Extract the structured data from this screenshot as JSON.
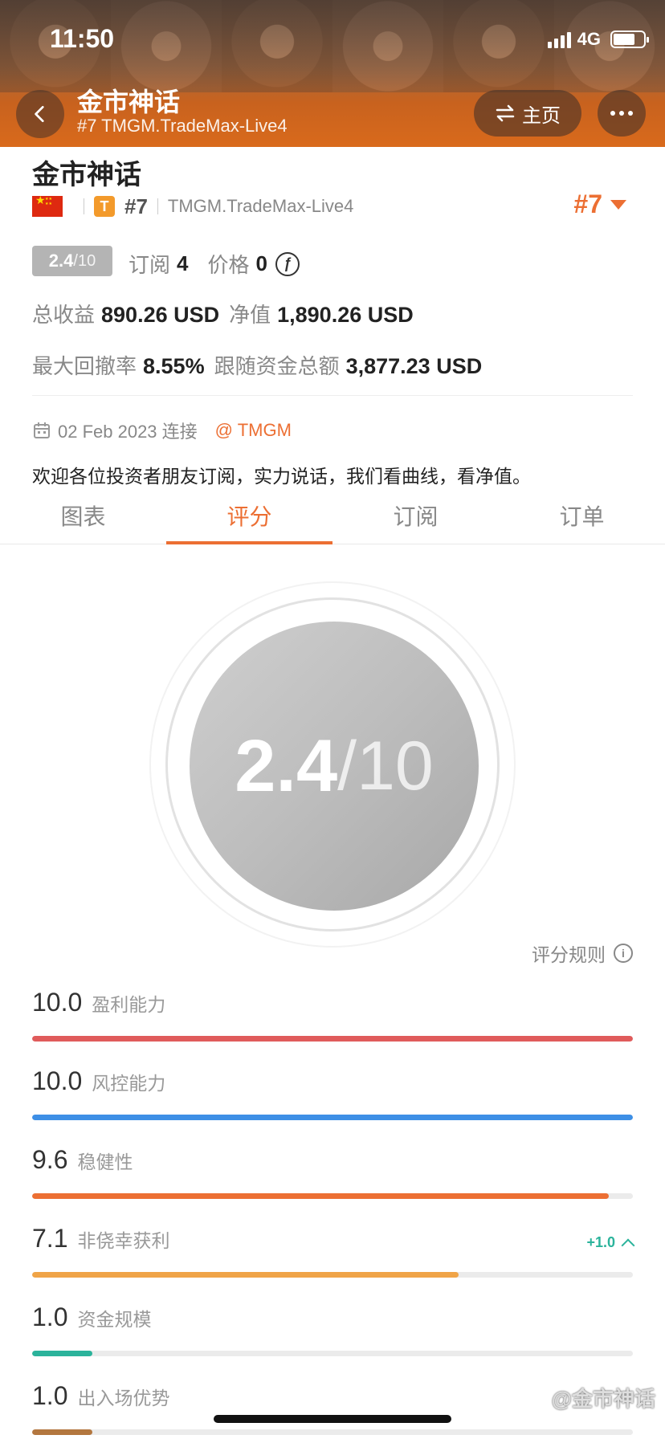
{
  "status_bar": {
    "time": "11:50",
    "network": "4G"
  },
  "header": {
    "title": "金市神话",
    "subtitle": "#7 TMGM.TradeMax-Live4",
    "home_label": "主页"
  },
  "profile": {
    "name": "金市神话",
    "badge_letter": "T",
    "rank_small": "#7",
    "server": "TMGM.TradeMax-Live4",
    "rank_big": "#7",
    "score_chip": {
      "value": "2.4",
      "denominator": "/10"
    },
    "subscribers_label": "订阅",
    "subscribers_value": "4",
    "price_label": "价格",
    "price_value": "0",
    "coin_symbol": "ƒ",
    "total_profit_label": "总收益",
    "total_profit_value": "890.26 USD",
    "equity_label": "净值",
    "equity_value": "1,890.26 USD",
    "max_drawdown_label": "最大回撤率",
    "max_drawdown_value": "8.55%",
    "follow_funds_label": "跟随资金总额",
    "follow_funds_value": "3,877.23 USD",
    "connect_date": "02 Feb 2023 连接",
    "broker_handle": "@ TMGM",
    "description": "欢迎各位投资者朋友订阅，实力说话，我们看曲线，看净值。"
  },
  "tabs": [
    {
      "label": "图表",
      "active": false
    },
    {
      "label": "评分",
      "active": true
    },
    {
      "label": "订阅",
      "active": false
    },
    {
      "label": "订单",
      "active": false
    }
  ],
  "score": {
    "value": "2.4",
    "denominator": "/10",
    "rules_label": "评分规则"
  },
  "metrics": [
    {
      "value": "10.0",
      "label": "盈利能力",
      "fraction": 1.0,
      "color": "#e05b5b",
      "delta": ""
    },
    {
      "value": "10.0",
      "label": "风控能力",
      "fraction": 1.0,
      "color": "#3d8fe6",
      "delta": ""
    },
    {
      "value": "9.6",
      "label": "稳健性",
      "fraction": 0.96,
      "color": "#ec6f33",
      "delta": ""
    },
    {
      "value": "7.1",
      "label": "非侥幸获利",
      "fraction": 0.71,
      "color": "#f0a447",
      "delta": "+1.0"
    },
    {
      "value": "1.0",
      "label": "资金规模",
      "fraction": 0.1,
      "color": "#2bb39b",
      "delta": ""
    },
    {
      "value": "1.0",
      "label": "出入场优势",
      "fraction": 0.1,
      "color": "#b3773f",
      "delta": ""
    }
  ],
  "watermark": "@金市神话",
  "colors": {
    "accent": "#ec6f33",
    "score_disc": "#bdbdbd",
    "positive": "#2bb39b"
  }
}
